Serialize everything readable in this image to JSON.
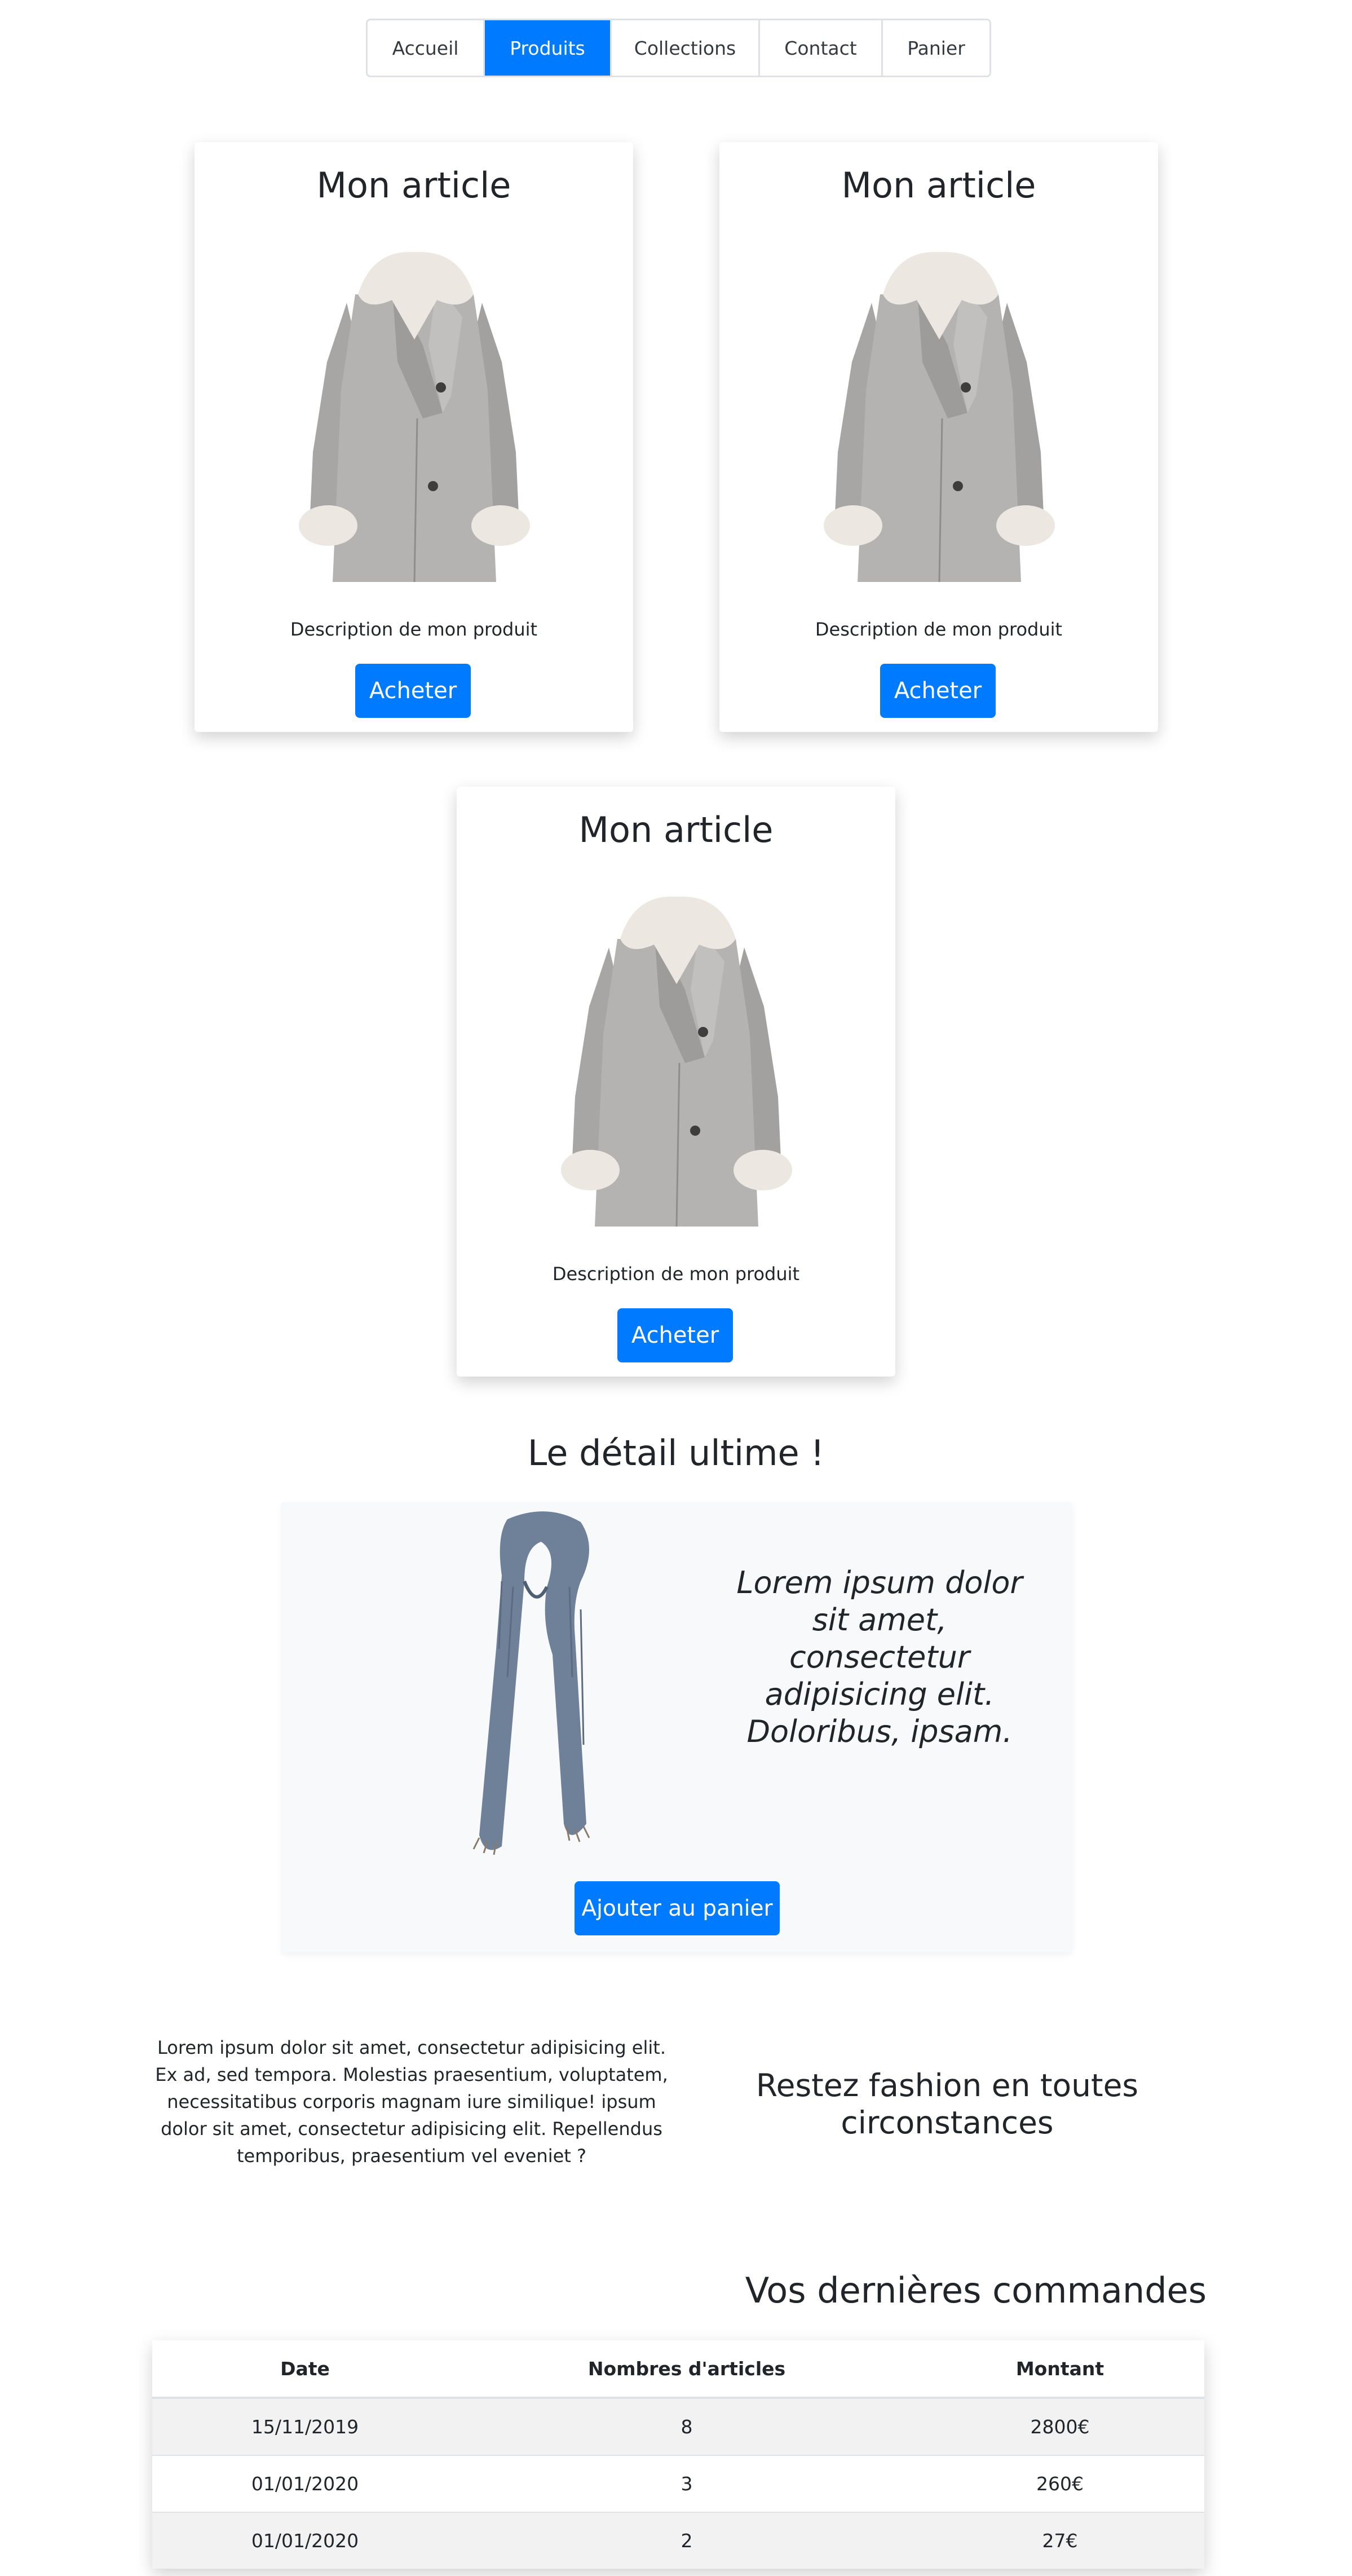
{
  "nav": {
    "items": [
      {
        "label": "Accueil",
        "active": false
      },
      {
        "label": "Produits",
        "active": true
      },
      {
        "label": "Collections",
        "active": false
      },
      {
        "label": "Contact",
        "active": false
      },
      {
        "label": "Panier",
        "active": false
      }
    ]
  },
  "products": [
    {
      "title": "Mon article",
      "description": "Description de mon produit",
      "button": "Acheter"
    },
    {
      "title": "Mon article",
      "description": "Description de mon produit",
      "button": "Acheter"
    },
    {
      "title": "Mon article",
      "description": "Description de mon produit",
      "button": "Acheter"
    }
  ],
  "detail": {
    "heading": "Le détail ultime !",
    "text": "Lorem ipsum dolor sit amet, consectetur adipisicing elit. Doloribus, ipsam.",
    "button": "Ajouter au panier"
  },
  "fashion": {
    "paragraph": "Lorem ipsum dolor sit amet, consectetur adipisicing elit. Ex ad, sed tempora. Molestias praesentium, voluptatem, necessitatibus corporis magnam iure similique! ipsum dolor sit amet, consectetur adipisicing elit. Repellendus temporibus, praesentium vel eveniet ?",
    "heading": "Restez fashion en toutes circonstances"
  },
  "orders": {
    "heading": "Vos dernières commandes",
    "columns": [
      "Date",
      "Nombres d'articles",
      "Montant"
    ],
    "rows": [
      [
        "15/11/2019",
        "8",
        "2800€"
      ],
      [
        "01/01/2020",
        "3",
        "260€"
      ],
      [
        "01/01/2020",
        "2",
        "27€"
      ]
    ]
  },
  "colors": {
    "primary": "#007bff",
    "text": "#212529",
    "border": "#dee2e6"
  }
}
